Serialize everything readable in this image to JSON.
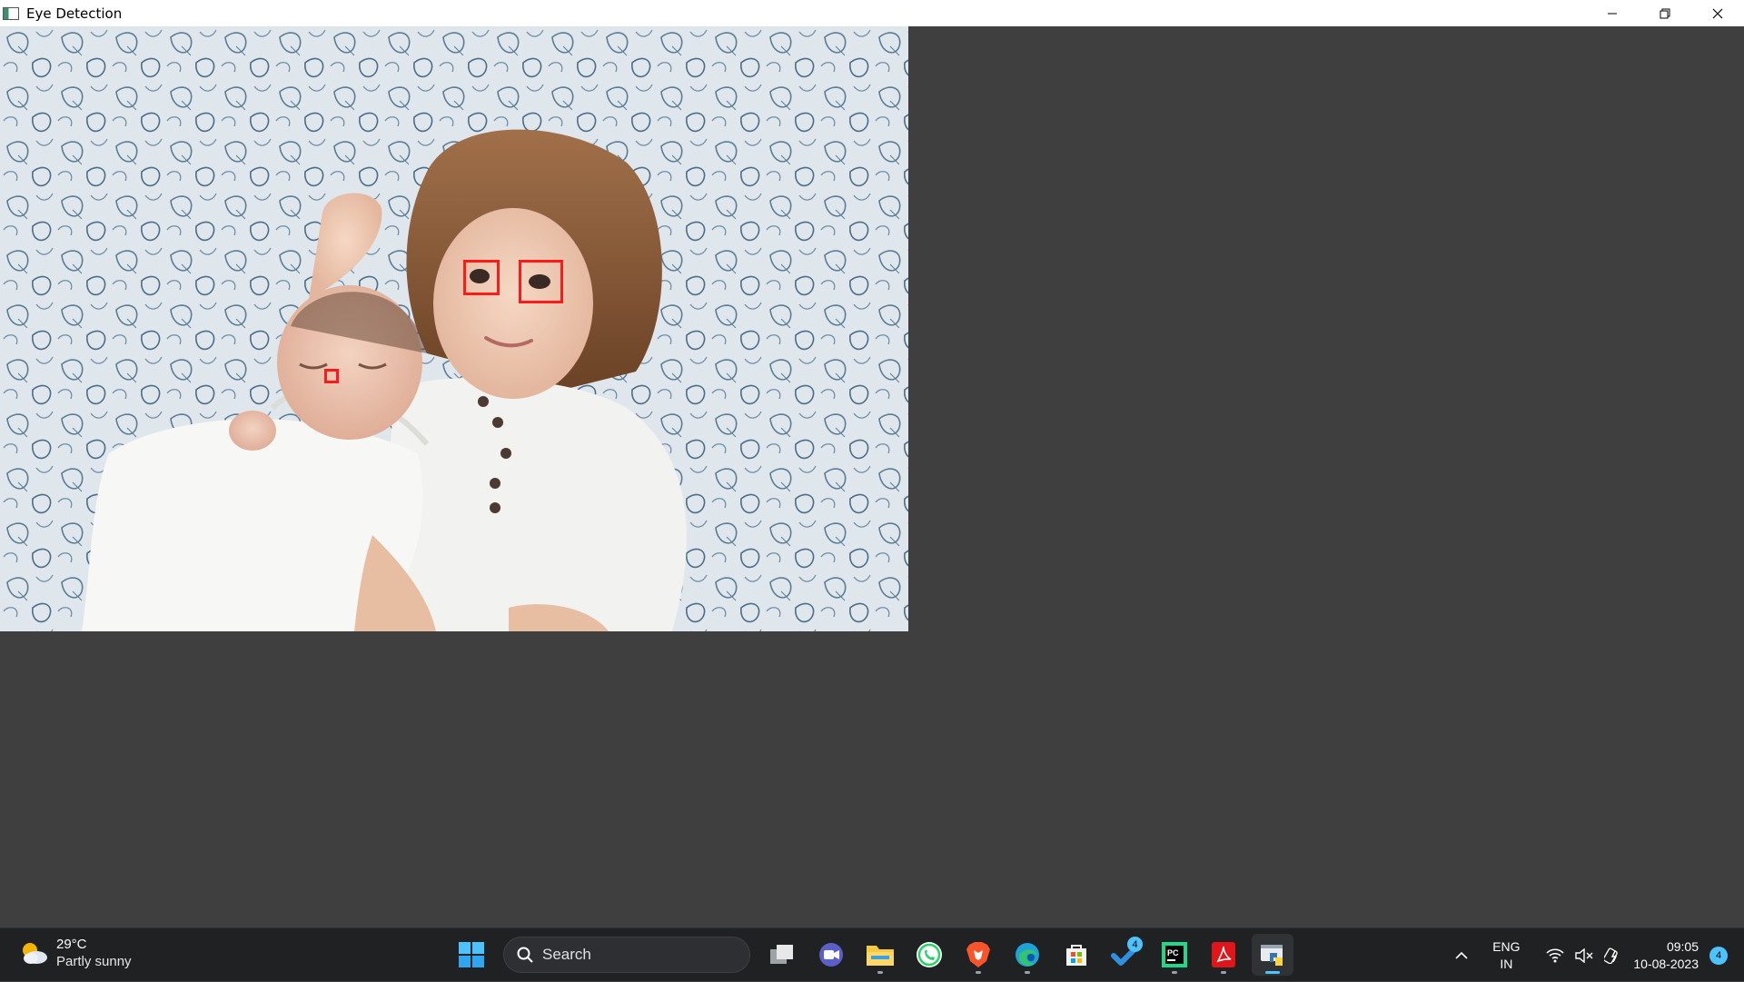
{
  "window": {
    "title": "Eye Detection"
  },
  "detections": {
    "count": 3,
    "box_color": "#ff1a1a"
  },
  "taskbar": {
    "weather": {
      "temperature": "29°C",
      "condition": "Partly sunny",
      "icon": "partly-sunny-icon"
    },
    "search": {
      "placeholder": "Search"
    },
    "apps": [
      {
        "name": "start-button",
        "icon": "windows-logo-icon"
      },
      {
        "name": "task-view",
        "icon": "task-view-icon"
      },
      {
        "name": "teams-meet",
        "icon": "video-camera-icon"
      },
      {
        "name": "file-explorer",
        "icon": "folder-icon"
      },
      {
        "name": "whatsapp",
        "icon": "whatsapp-icon"
      },
      {
        "name": "brave",
        "icon": "brave-icon"
      },
      {
        "name": "edge",
        "icon": "edge-icon"
      },
      {
        "name": "store",
        "icon": "store-icon"
      },
      {
        "name": "todo",
        "icon": "check-icon",
        "badge": "4"
      },
      {
        "name": "pycharm",
        "icon": "pycharm-icon"
      },
      {
        "name": "acrobat",
        "icon": "pdf-icon"
      },
      {
        "name": "python-window",
        "icon": "python-icon",
        "active": true
      }
    ],
    "tray": {
      "language": "ENG",
      "region": "IN",
      "time": "09:05",
      "date": "10-08-2023",
      "notification_count": "4"
    }
  },
  "colors": {
    "taskbar_bg": "#1f2123",
    "client_bg": "#3f3f3f",
    "accent": "#4cc2ff"
  }
}
